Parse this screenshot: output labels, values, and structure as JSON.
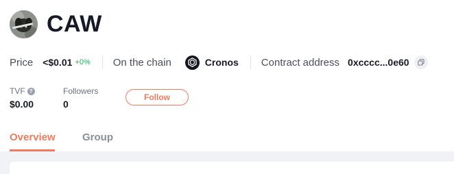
{
  "token": {
    "name": "CAW",
    "avatar_icon": "dog-avatar-icon"
  },
  "info": {
    "price_label": "Price",
    "price_value": "<$0.01",
    "price_change": "+0%",
    "chain_label": "On the chain",
    "chain_icon": "cronos-chain-icon",
    "chain_name": "Cronos",
    "contract_label": "Contract address",
    "contract_value": "0xcccc...0e60",
    "copy_icon": "copy-icon"
  },
  "stats": {
    "tvf_label": "TVF",
    "tvf_help_icon": "help-circle-icon",
    "tvf_value": "$0.00",
    "followers_label": "Followers",
    "followers_value": "0"
  },
  "actions": {
    "follow_label": "Follow"
  },
  "tabs": [
    {
      "label": "Overview",
      "active": true
    },
    {
      "label": "Group",
      "active": false
    }
  ],
  "colors": {
    "accent": "#f07a5c",
    "positive": "#1fb55a",
    "text_primary": "#161a26",
    "text_secondary": "#4a4f5c",
    "tab_inactive": "#8a8f9c"
  }
}
